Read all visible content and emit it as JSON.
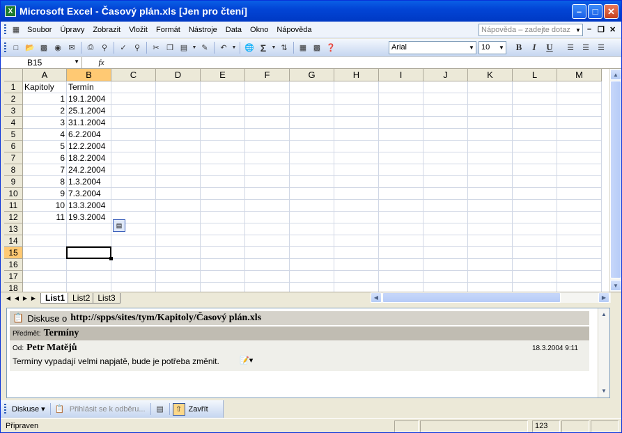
{
  "window": {
    "title": "Microsoft Excel - Časový plán.xls  [Jen pro čtení]",
    "app_icon": "X"
  },
  "menu": {
    "items": [
      "Soubor",
      "Úpravy",
      "Zobrazit",
      "Vložit",
      "Formát",
      "Nástroje",
      "Data",
      "Okno",
      "Nápověda"
    ],
    "help_placeholder": "Nápověda – zadejte dotaz"
  },
  "toolbar": {
    "font": "Arial",
    "size": "10",
    "bold": "B",
    "italic": "I",
    "underline": "U"
  },
  "formula_bar": {
    "name_box": "B15",
    "fx_symbol": "fx",
    "content": ""
  },
  "grid": {
    "columns": [
      "A",
      "B",
      "C",
      "D",
      "E",
      "F",
      "G",
      "H",
      "I",
      "J",
      "K",
      "L",
      "M"
    ],
    "rows": [
      "1",
      "2",
      "3",
      "4",
      "5",
      "6",
      "7",
      "8",
      "9",
      "10",
      "11",
      "12",
      "13",
      "14",
      "15",
      "16",
      "17",
      "18"
    ],
    "header": [
      "Kapitoly",
      "Termín"
    ],
    "data": [
      [
        "1",
        "19.1.2004"
      ],
      [
        "2",
        "25.1.2004"
      ],
      [
        "3",
        "31.1.2004"
      ],
      [
        "4",
        "6.2.2004"
      ],
      [
        "5",
        "12.2.2004"
      ],
      [
        "6",
        "18.2.2004"
      ],
      [
        "7",
        "24.2.2004"
      ],
      [
        "8",
        "1.3.2004"
      ],
      [
        "9",
        "7.3.2004"
      ],
      [
        "10",
        "13.3.2004"
      ],
      [
        "11",
        "19.3.2004"
      ]
    ],
    "active_cell": "B15"
  },
  "sheets": {
    "tabs": [
      "List1",
      "List2",
      "List3"
    ],
    "active": "List1"
  },
  "discussion": {
    "header_prefix": "Diskuse o",
    "url": "http://spps/sites/tym/Kapitoly/Časový plán.xls",
    "subject_label": "Předmět:",
    "subject": "Termíny",
    "from_label": "Od:",
    "author": "Petr Matějů",
    "timestamp": "18.3.2004 9:11",
    "message": "Termíny vypadají velmi napjatě, bude je potřeba změnit."
  },
  "discussion_toolbar": {
    "discuss": "Diskuse",
    "subscribe": "Přihlásit se k odběru...",
    "close": "Zavřít"
  },
  "status": {
    "text": "Připraven",
    "indicator": "123"
  },
  "colors": {
    "title_bar": "#0245d6",
    "selection_header": "#ffc973",
    "toolbar": "#c5d6f0"
  }
}
